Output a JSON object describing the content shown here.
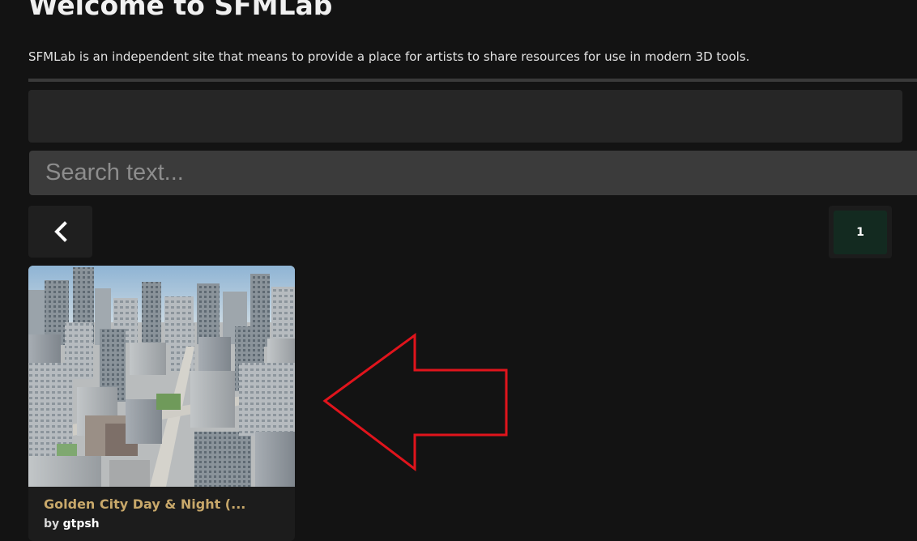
{
  "header": {
    "title": "Welcome to SFMLab",
    "description": "SFMLab is an independent site that means to provide a place for artists to share resources for use in modern 3D tools."
  },
  "search": {
    "placeholder": "Search text..."
  },
  "pagination": {
    "prev_icon": "chevron-left-icon",
    "current_page": "1"
  },
  "results": [
    {
      "title": "Golden City Day & Night (...",
      "by_label": "by",
      "author": "gtpsh",
      "thumbnail": "aerial city skyline render"
    }
  ],
  "annotation": {
    "icon": "red-arrow-pointing-left",
    "color": "#e0141c"
  },
  "colors": {
    "background": "#131313",
    "card_title": "#c8a86a",
    "active_page": "#132a20"
  }
}
